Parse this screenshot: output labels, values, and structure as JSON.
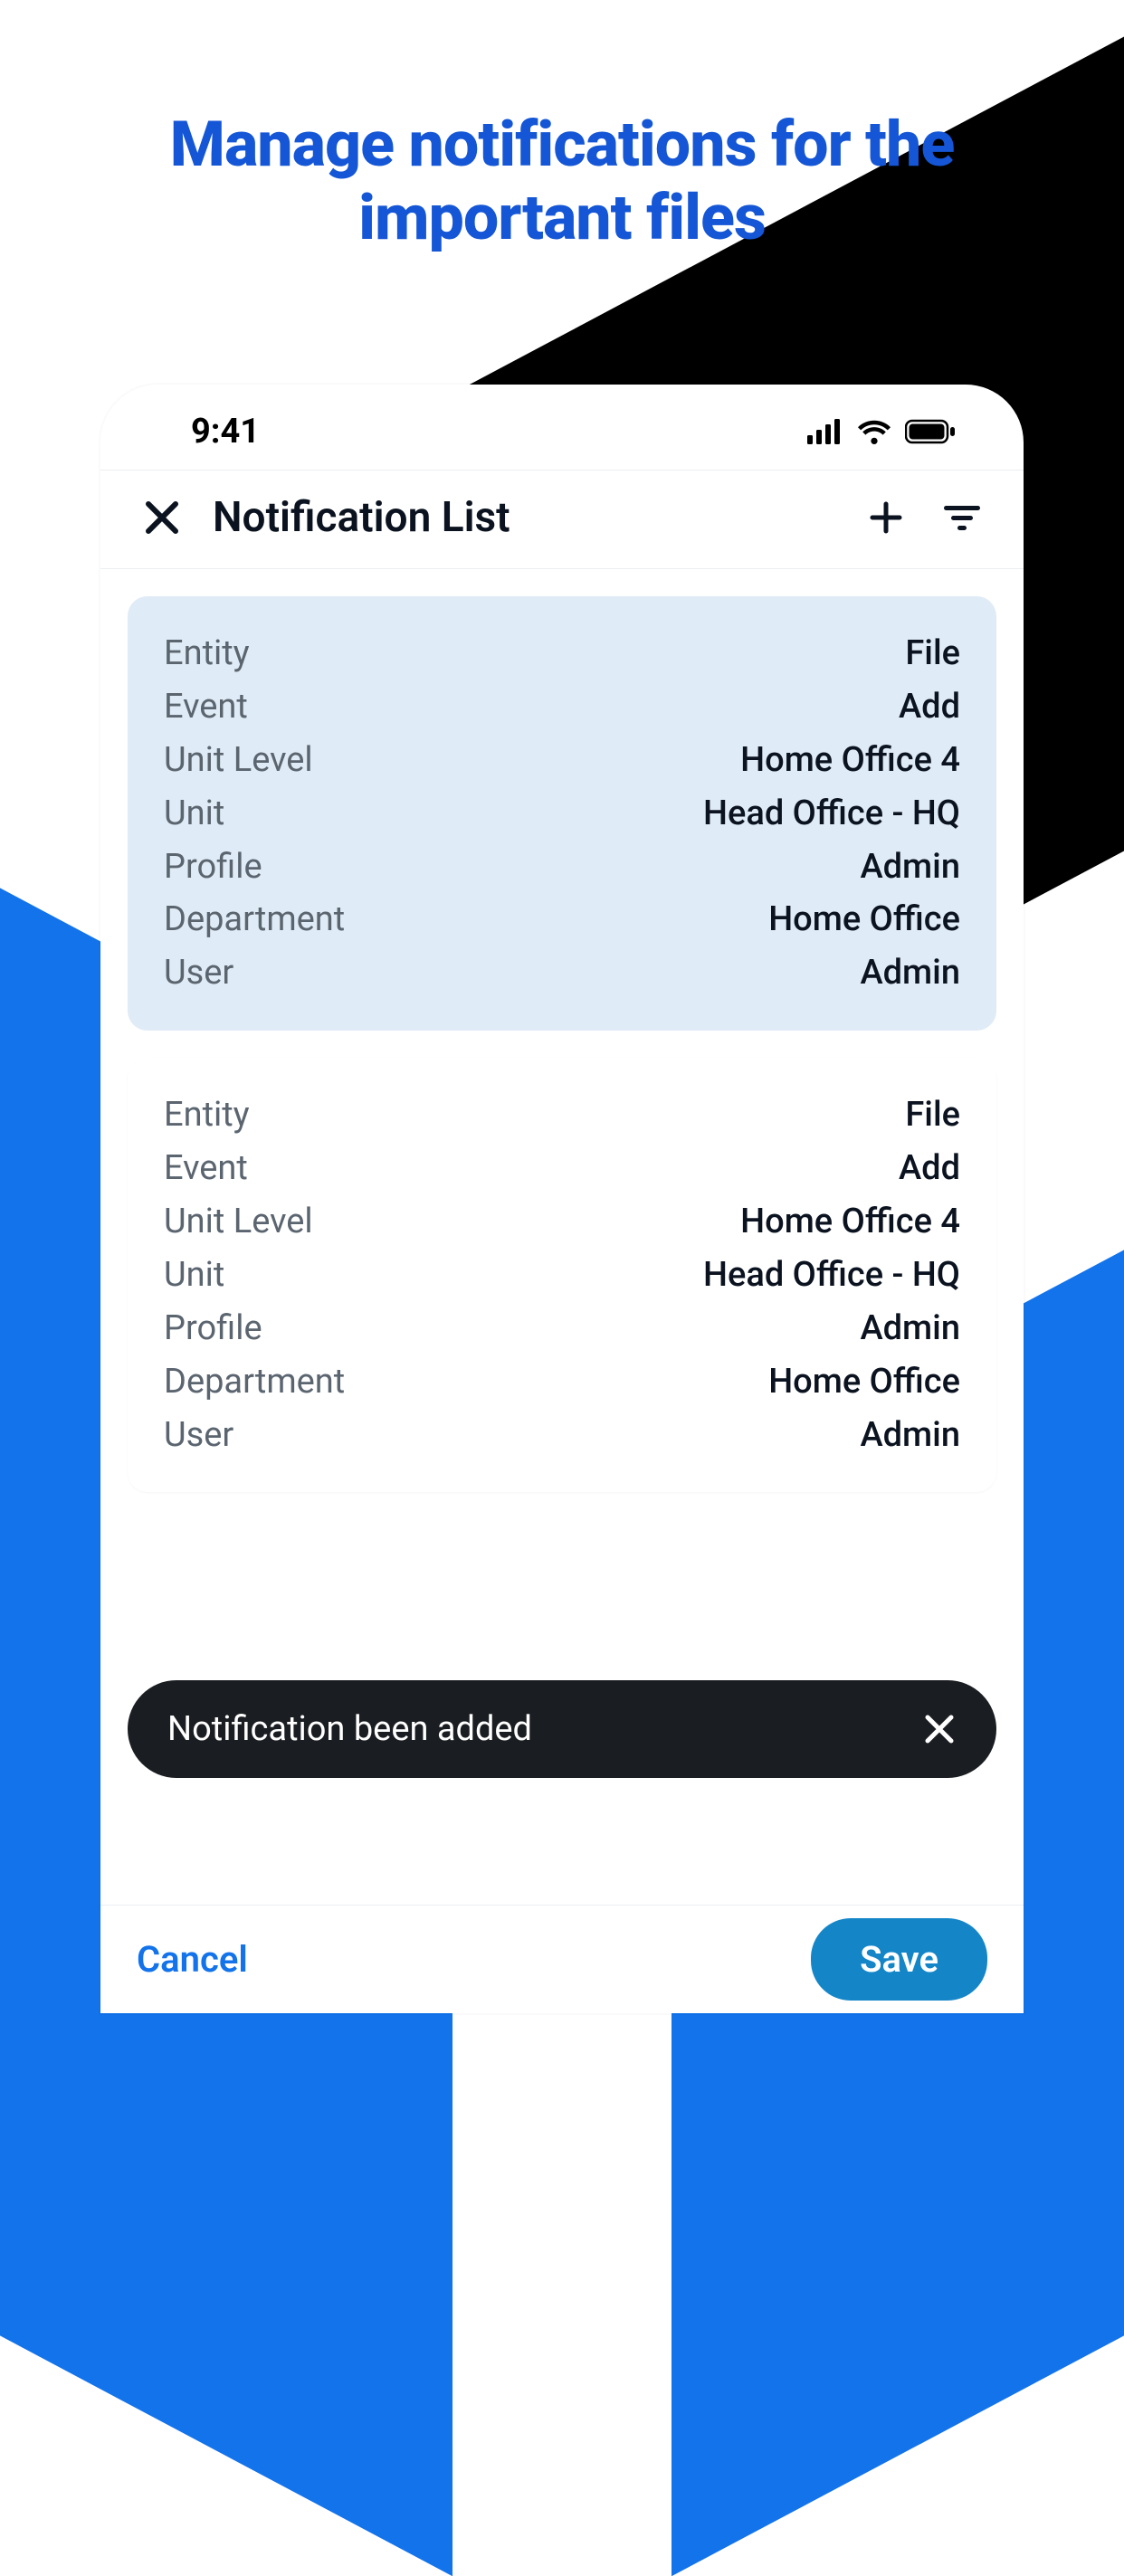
{
  "headline": "Manage notifications for the important files",
  "status": {
    "time": "9:41"
  },
  "nav": {
    "title": "Notification List"
  },
  "labels": {
    "entity": "Entity",
    "event": "Event",
    "unitLevel": "Unit Level",
    "unit": "Unit",
    "profile": "Profile",
    "department": "Department",
    "user": "User"
  },
  "cards": [
    {
      "entity": "File",
      "event": "Add",
      "unitLevel": "Home Office 4",
      "unit": "Head Office - HQ",
      "profile": "Admin",
      "department": "Home Office",
      "user": "Admin"
    },
    {
      "entity": "File",
      "event": "Add",
      "unitLevel": "Home Office 4",
      "unit": "Head Office - HQ",
      "profile": "Admin",
      "department": "Home Office",
      "user": "Admin"
    }
  ],
  "toast": {
    "message": "Notification been added"
  },
  "footer": {
    "cancel": "Cancel",
    "save": "Save"
  }
}
